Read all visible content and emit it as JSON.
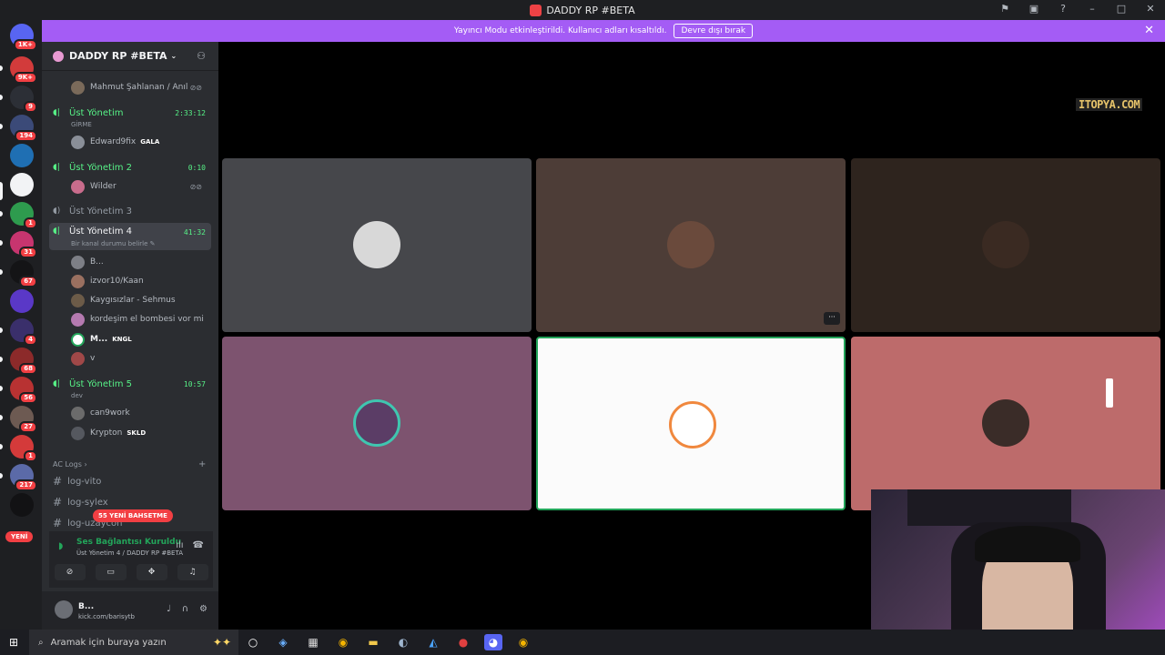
{
  "window": {
    "title": "DADDY RP #BETA"
  },
  "banner": {
    "text": "Yayıncı Modu etkinleştirildi. Kullanıcı adları kısaltıldı.",
    "button": "Devre dışı bırak"
  },
  "servers": {
    "badges": [
      "1K+",
      "9K+",
      "9",
      "194",
      "",
      "",
      "1",
      "31",
      "67",
      "",
      "4",
      "68",
      "56",
      "27",
      "1",
      "217",
      ""
    ],
    "new_label": "YENİ"
  },
  "server_header": {
    "name": "DADDY RP #BETA"
  },
  "channels": {
    "top_user": {
      "name": "Mahmut Şahlanan / Anıl"
    },
    "vc1": {
      "name": "Üst Yönetim",
      "time": "2:33:12",
      "status": "GİRME",
      "users": [
        {
          "name": "Edward9fix",
          "tag": "GALA"
        }
      ]
    },
    "vc2": {
      "name": "Üst Yönetim 2",
      "time": "0:10",
      "users": [
        {
          "name": "Wilder"
        }
      ]
    },
    "vc3": {
      "name": "Üst Yönetim 3"
    },
    "vc4": {
      "name": "Üst Yönetim 4",
      "time": "41:32",
      "status": "Bir kanal durumu belirle",
      "users": [
        {
          "name": "B..."
        },
        {
          "name": "izvor10/Kaan"
        },
        {
          "name": "Kaygısızlar - Sehmus"
        },
        {
          "name": "kordeşim el bombesi vor mi"
        },
        {
          "name": "M...",
          "tag": "KNGL"
        },
        {
          "name": "v"
        }
      ]
    },
    "vc5": {
      "name": "Üst Yönetim 5",
      "time": "10:57",
      "status": "dev",
      "users": [
        {
          "name": "can9work"
        },
        {
          "name": "Krypton",
          "tag": "SKLD"
        }
      ]
    },
    "category": "AC Logs",
    "text_channels": [
      "log-vito",
      "log-sylex",
      "log-uzaycon"
    ],
    "mention_pill": "55 YENİ BAHSETME"
  },
  "voice_status": {
    "title": "Ses Bağlantısı Kuruldu",
    "subtitle": "Üst Yönetim 4 / DADDY RP #BETA"
  },
  "user_panel": {
    "name": "B...",
    "status": "kick.com/barisytb"
  },
  "overlay": {
    "watermark": "ITOPYA.COM"
  },
  "tiles": [
    {
      "bg": "#46474b"
    },
    {
      "bg": "#4d3d37",
      "menu": "···"
    },
    {
      "bg": "#2e241e"
    },
    {
      "bg": "#7d536f"
    },
    {
      "bg": "#fbfbfb",
      "speaking": true
    },
    {
      "bg": "#bd6b6b"
    }
  ],
  "taskbar": {
    "search_placeholder": "Aramak için buraya yazın"
  },
  "colors": {
    "accent": "#a45cf5",
    "online": "#23a55a",
    "voice": "#57f287",
    "danger": "#f23f43"
  }
}
